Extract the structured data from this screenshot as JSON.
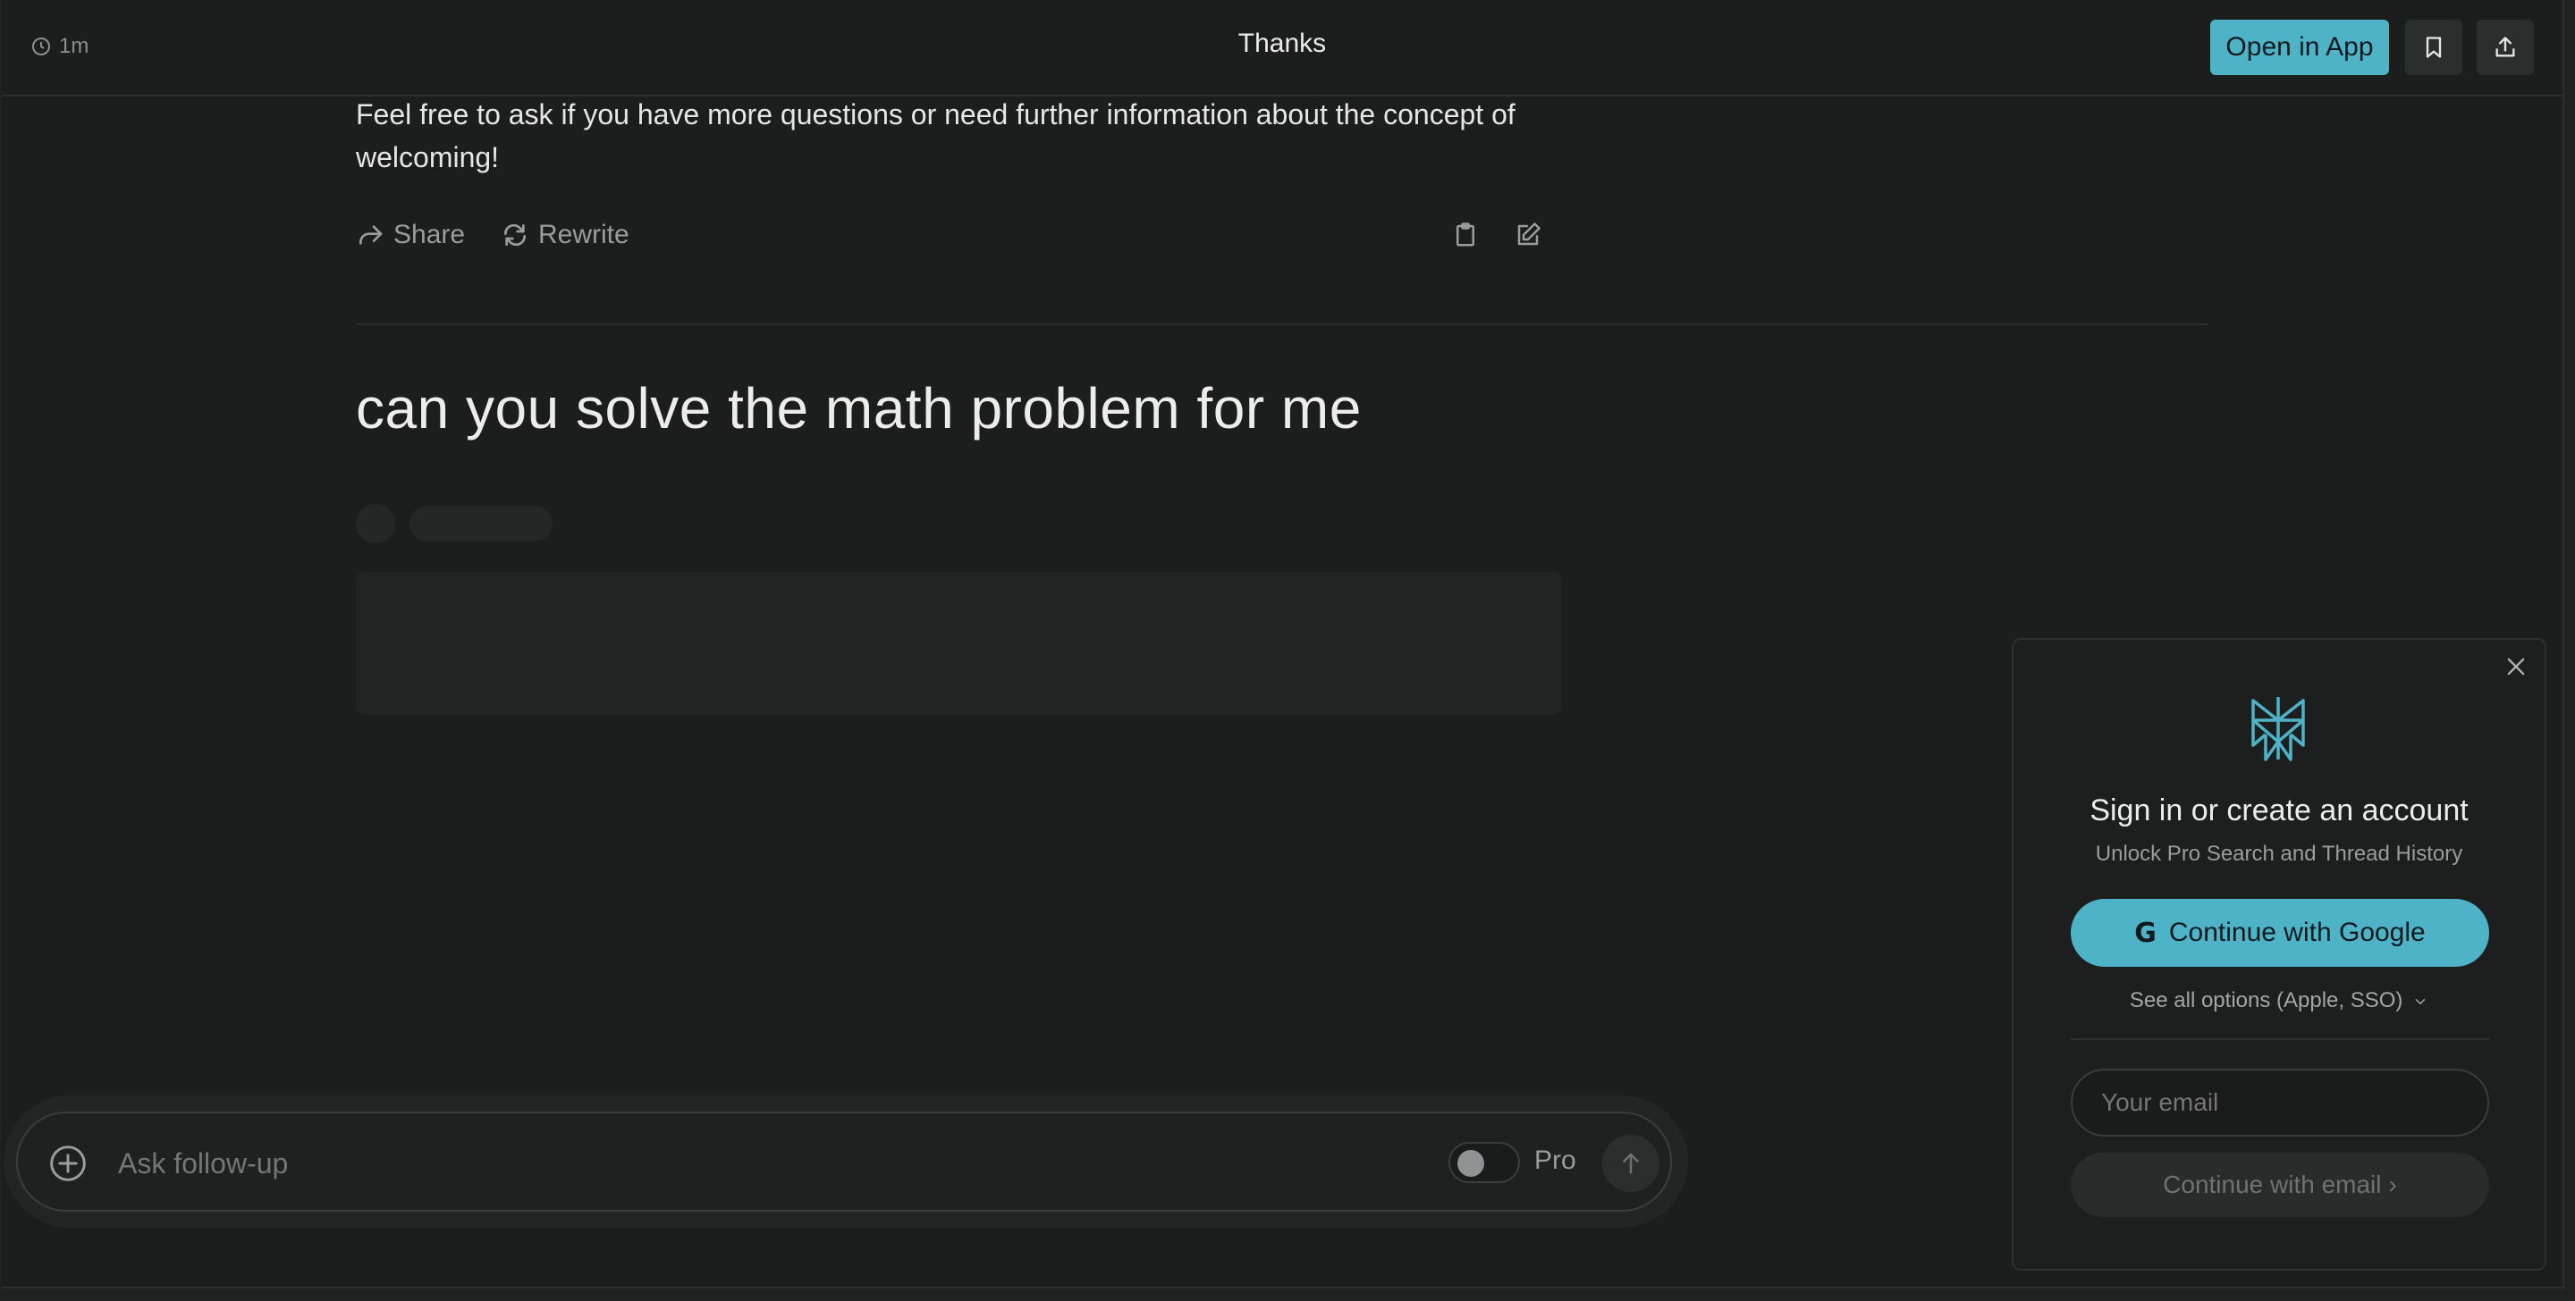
{
  "header": {
    "time": "1m",
    "title": "Thanks",
    "open_in_app": "Open in App"
  },
  "answer": {
    "text": "Feel free to ask if you have more questions or need further information about the concept of welcoming!",
    "share_label": "Share",
    "rewrite_label": "Rewrite"
  },
  "question": {
    "text": "can you solve the math problem for me"
  },
  "followup": {
    "placeholder": "Ask follow-up",
    "pro_label": "Pro",
    "pro_enabled": false
  },
  "signin": {
    "title": "Sign in or create an account",
    "subtitle": "Unlock Pro Search and Thread History",
    "google_label": "Continue with Google",
    "google_icon_glyph": "G",
    "options_label": "See all options (Apple, SSO)",
    "email_placeholder": "Your email",
    "email_button": "Continue with email",
    "email_button_arrow": "›"
  },
  "colors": {
    "accent": "#4fb3c8",
    "background": "#1c1d1d"
  }
}
